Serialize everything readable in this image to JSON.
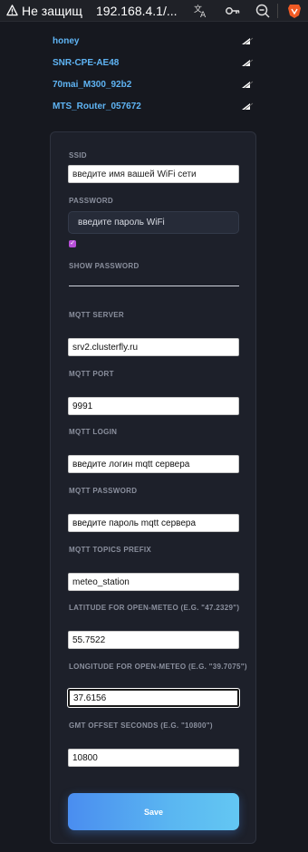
{
  "browser": {
    "insecure_label": "Не защищ",
    "url": "192.168.4.1/..."
  },
  "networks": [
    {
      "name": "honey",
      "signal_icon": "wifi-signal-icon"
    },
    {
      "name": "SNR-CPE-AE48",
      "signal_icon": "wifi-signal-icon"
    },
    {
      "name": "70mai_M300_92b2",
      "signal_icon": "wifi-signal-icon"
    },
    {
      "name": "MTS_Router_057672",
      "signal_icon": "wifi-signal-icon"
    }
  ],
  "form": {
    "ssid_label": "SSID",
    "ssid_placeholder": "введите имя вашей WiFi сети",
    "password_label": "PASSWORD",
    "password_placeholder": "введите пароль WiFi",
    "show_password_checked": true,
    "show_password_label": "SHOW PASSWORD",
    "mqtt_server_label": "MQTT SERVER",
    "mqtt_server_value": "srv2.clusterfly.ru",
    "mqtt_port_label": "MQTT PORT",
    "mqtt_port_value": "9991",
    "mqtt_login_label": "MQTT LOGIN",
    "mqtt_login_value": "введите логин mqtt сервера",
    "mqtt_password_label": "MQTT PASSWORD",
    "mqtt_password_value": "введите пароль mqtt сервера",
    "mqtt_prefix_label": "MQTT TOPICS PREFIX",
    "mqtt_prefix_value": "meteo_station",
    "latitude_label": "LATITUDE FOR OPEN-METEO (E.G. \"47.2329\")",
    "latitude_value": "55.7522",
    "longitude_label": "LONGITUDE FOR OPEN-METEO (E.G. \"39.7075\")",
    "longitude_value": "37.6156",
    "gmt_label": "GMT OFFSET SECONDS (E.G. \"10800\")",
    "gmt_value": "10800",
    "save_label": "Save"
  },
  "colors": {
    "accent": "#5fb4f4",
    "checkbox": "#b84fd8",
    "button_start": "#4a8df0",
    "button_end": "#63c7f3"
  }
}
